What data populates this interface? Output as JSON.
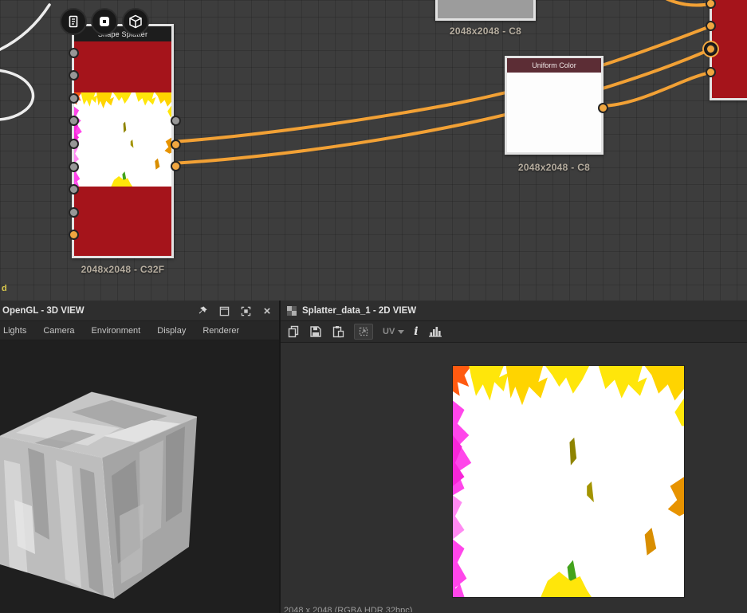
{
  "graph": {
    "shape_splatter": {
      "title": "Shape Splatter",
      "size_label": "2048x2048 - C32F"
    },
    "top_node": {
      "size_label": "2048x2048 - C8"
    },
    "uniform_color": {
      "title": "Uniform Color",
      "size_label": "2048x2048 - C8"
    },
    "cut_label": "d",
    "quick_icons": [
      "document-icon",
      "shape-icon",
      "cube-icon"
    ]
  },
  "panels": {
    "view3d": {
      "title": "OpenGL - 3D VIEW",
      "menu": [
        "Lights",
        "Camera",
        "Environment",
        "Display",
        "Renderer"
      ],
      "close_glyph": "×",
      "header_icons": [
        "pin-icon",
        "float-window-icon",
        "maximize-icon",
        "close-icon"
      ]
    },
    "view2d": {
      "title": "Splatter_data_1 - 2D VIEW",
      "toolbar": {
        "uv_label": "UV",
        "info_glyph": "i",
        "icons": [
          "copy-icon",
          "save-icon",
          "paste-icon",
          "transform-icon",
          "uv-dropdown",
          "info-icon",
          "histogram-icon"
        ]
      },
      "status": "2048 x 2048 (RGBA HDR 32bpc)"
    }
  },
  "colors": {
    "wire_orange": "#f2a135",
    "port_orange": "#f0a640",
    "node_red": "#a5141b",
    "uniform_header_maroon": "#5c2d35",
    "splatter_yellow": "#ffe60a",
    "splatter_magenta": "#ff46ea",
    "label_tan": "#b6ad9f"
  }
}
